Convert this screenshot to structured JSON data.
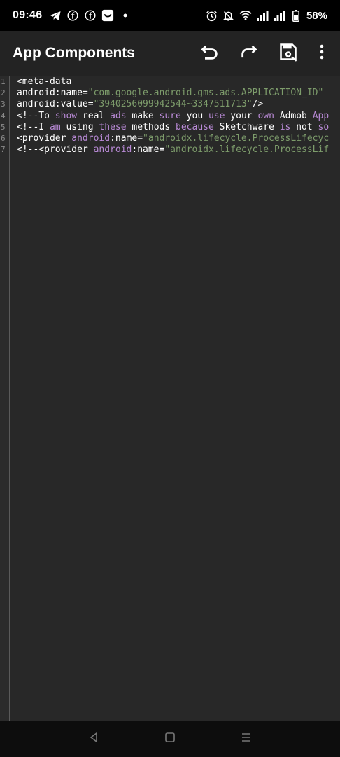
{
  "status_bar": {
    "time": "09:46",
    "battery_percent": "58%",
    "left_icons": [
      "telegram-icon",
      "facebook-icon",
      "facebook-icon",
      "shopping-bag-icon",
      "dot-icon"
    ],
    "right_icons": [
      "alarm-icon",
      "bell-off-icon",
      "wifi-icon",
      "signal-icon",
      "signal-icon",
      "battery-icon"
    ]
  },
  "toolbar": {
    "title": "App Components",
    "actions": [
      "undo-icon",
      "redo-icon",
      "save-icon",
      "more-vert-icon"
    ]
  },
  "editor": {
    "line_numbers": [
      "1",
      "2",
      "3",
      "4",
      "5",
      "6",
      "7"
    ],
    "lines": [
      [
        {
          "t": "<meta-data",
          "k": "plain"
        }
      ],
      [
        {
          "t": "android:name=",
          "k": "plain"
        },
        {
          "t": "\"com.google.android.gms.ads.APPLICATION_ID\"",
          "k": "str"
        }
      ],
      [
        {
          "t": "android:value=",
          "k": "plain"
        },
        {
          "t": "\"3940256099942544~3347511713\"",
          "k": "str"
        },
        {
          "t": "/>",
          "k": "plain"
        }
      ],
      [
        {
          "t": "<!--To ",
          "k": "plain"
        },
        {
          "t": "show",
          "k": "attr"
        },
        {
          "t": " real ",
          "k": "plain"
        },
        {
          "t": "ads",
          "k": "attr"
        },
        {
          "t": " make ",
          "k": "plain"
        },
        {
          "t": "sure",
          "k": "attr"
        },
        {
          "t": " you ",
          "k": "plain"
        },
        {
          "t": "use",
          "k": "attr"
        },
        {
          "t": " your ",
          "k": "plain"
        },
        {
          "t": "own",
          "k": "attr"
        },
        {
          "t": " Admob ",
          "k": "plain"
        },
        {
          "t": "App",
          "k": "attr"
        }
      ],
      [
        {
          "t": "<!--I ",
          "k": "plain"
        },
        {
          "t": "am",
          "k": "attr"
        },
        {
          "t": " using ",
          "k": "plain"
        },
        {
          "t": "these",
          "k": "attr"
        },
        {
          "t": " methods ",
          "k": "plain"
        },
        {
          "t": "because",
          "k": "attr"
        },
        {
          "t": " Sketchware ",
          "k": "plain"
        },
        {
          "t": "is",
          "k": "attr"
        },
        {
          "t": " not ",
          "k": "plain"
        },
        {
          "t": "so",
          "k": "attr"
        }
      ],
      [
        {
          "t": "<provider ",
          "k": "plain"
        },
        {
          "t": "android",
          "k": "attr"
        },
        {
          "t": ":name=",
          "k": "plain"
        },
        {
          "t": "\"androidx.lifecycle.ProcessLifecyc",
          "k": "str"
        }
      ],
      [
        {
          "t": "<!--<provider ",
          "k": "plain"
        },
        {
          "t": "android",
          "k": "attr"
        },
        {
          "t": ":name=",
          "k": "plain"
        },
        {
          "t": "\"androidx.lifecycle.ProcessLif",
          "k": "str"
        }
      ]
    ]
  },
  "nav_bar": {
    "buttons": [
      "back-icon",
      "home-icon",
      "recents-icon"
    ]
  }
}
